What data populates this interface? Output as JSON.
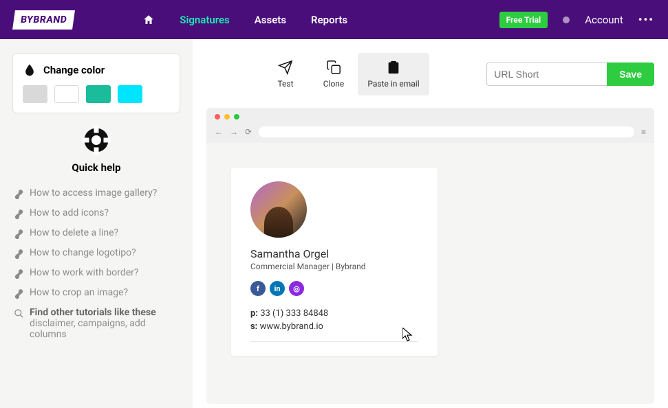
{
  "nav": {
    "logo": "BYBRAND",
    "items": {
      "signatures": "Signatures",
      "assets": "Assets",
      "reports": "Reports"
    },
    "free_trial": "Free Trial",
    "account": "Account"
  },
  "sidebar": {
    "color_title": "Change color",
    "swatches": [
      "#d9d9d9",
      "#ffffff",
      "#1abc9c",
      "#00e5ff"
    ],
    "quick_help_title": "Quick help",
    "help": [
      "How to access image gallery?",
      "How to add icons?",
      "How to delete a line?",
      "How to change logotipo?",
      "How to work with border?",
      "How to crop an image?"
    ],
    "find_bold": "Find other tutorials like these",
    "find_sub": "disclaimer, campaigns, add columns"
  },
  "actions": {
    "test": "Test",
    "clone": "Clone",
    "paste": "Paste in email",
    "url_placeholder": "URL Short",
    "save": "Save"
  },
  "signature": {
    "name": "Samantha Orgel",
    "role": "Commercial Manager | Bybrand",
    "phone_label": "p:",
    "phone_value": "33 (1) 333 84848",
    "site_label": "s:",
    "site_value": "www.bybrand.io"
  }
}
